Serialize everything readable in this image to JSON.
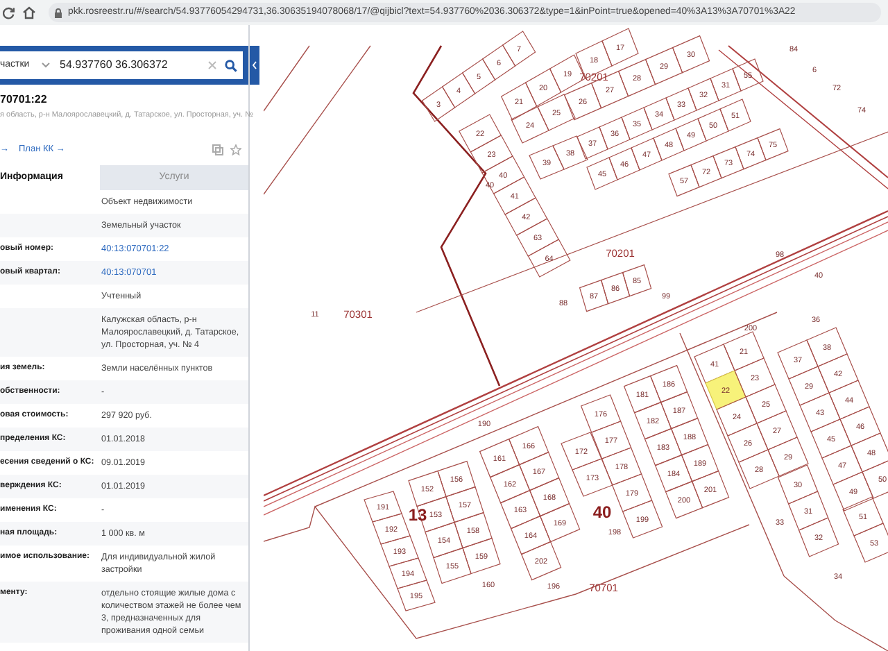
{
  "browser": {
    "url": "pkk.rosreestr.ru/#/search/54.93776054294731,36.30635194078068/17/@qijbicl?text=54.937760%2036.306372&type=1&inPoint=true&opened=40%3A13%3A70701%3A22"
  },
  "search": {
    "category": "частки",
    "value": "54.937760 36.306372"
  },
  "object": {
    "title": "70701:22",
    "address": "я область, р-н Малоярославецкий, д. Татарское, ул. Просторная, уч. №"
  },
  "links": [
    {
      "text": "→"
    },
    {
      "text": "План КК →"
    }
  ],
  "tabs": [
    {
      "label": "Информация",
      "selected": true
    },
    {
      "label": "Услуги",
      "selected": false
    }
  ],
  "rows": [
    {
      "value": "Объект недвижимости",
      "kind": "text"
    },
    {
      "value": "Земельный участок",
      "kind": "text"
    },
    {
      "label": "овый номер:",
      "value": "40:13:070701:22",
      "kind": "link"
    },
    {
      "label": "овый квартал:",
      "value": "40:13:070701",
      "kind": "link"
    },
    {
      "value": "Учтенный",
      "kind": "text"
    },
    {
      "value": "Калужская область, р-н Малоярославецкий, д. Татарское, ул. Просторная, уч. № 4",
      "kind": "text"
    },
    {
      "label": "ия земель:",
      "value": "Земли населённых пунктов",
      "kind": "text"
    },
    {
      "label": "обственности:",
      "value": "-",
      "kind": "text"
    },
    {
      "label": "овая стоимость:",
      "value": "297 920 руб.",
      "kind": "text"
    },
    {
      "label": "пределения КС:",
      "value": "01.01.2018",
      "kind": "text"
    },
    {
      "label": "есения сведений о КС:",
      "value": "09.01.2019",
      "kind": "text"
    },
    {
      "label": "верждения КС:",
      "value": "01.01.2019",
      "kind": "text"
    },
    {
      "label": "именения КС:",
      "value": "-",
      "kind": "text"
    },
    {
      "label": "ная площадь:",
      "value": "1 000 кв. м",
      "kind": "text"
    },
    {
      "label": "имое использование:",
      "value": "Для индивидуальной жилой застройки",
      "kind": "text"
    },
    {
      "label": "менту:",
      "value": "отдельно стоящие жилые дома с количеством этажей не более чем 3, предназначенных для проживания одной семьи",
      "kind": "text"
    }
  ],
  "map": {
    "blocks": [
      {
        "plots": [
          {
            "number": "3",
            "selected": false
          },
          {
            "number": "4",
            "selected": false
          },
          {
            "number": "5",
            "selected": false
          },
          {
            "number": "6",
            "selected": false
          },
          {
            "number": "7",
            "selected": false
          }
        ]
      },
      {
        "plots": [
          {
            "number": "21",
            "selected": false
          },
          {
            "number": "20",
            "selected": false
          },
          {
            "number": "19",
            "selected": false
          }
        ]
      },
      {
        "plots": [
          {
            "number": "26",
            "selected": false
          },
          {
            "number": "27",
            "selected": false
          },
          {
            "number": "28",
            "selected": false
          },
          {
            "number": "29",
            "selected": false
          },
          {
            "number": "30",
            "selected": false
          }
        ]
      },
      {
        "plots": [
          {
            "number": "18",
            "selected": false
          },
          {
            "number": "17",
            "selected": false
          }
        ]
      },
      {
        "plots": [
          {
            "number": "24",
            "selected": false
          },
          {
            "number": "25",
            "selected": false
          }
        ]
      },
      {
        "plots": [
          {
            "number": "22",
            "selected": false
          },
          {
            "number": "23",
            "selected": false
          },
          {
            "number": "40",
            "selected": false
          },
          {
            "number": "41",
            "selected": false
          },
          {
            "number": "42",
            "selected": false
          },
          {
            "number": "63",
            "selected": false
          },
          {
            "number": "64",
            "selected": false
          }
        ]
      },
      {
        "plots": [
          {
            "number": "39",
            "selected": false
          },
          {
            "number": "38",
            "selected": false
          }
        ]
      },
      {
        "plots": [
          {
            "number": "37",
            "selected": false
          },
          {
            "number": "36",
            "selected": false
          },
          {
            "number": "35",
            "selected": false
          },
          {
            "number": "34",
            "selected": false
          },
          {
            "number": "33",
            "selected": false
          },
          {
            "number": "32",
            "selected": false
          },
          {
            "number": "31",
            "selected": false
          },
          {
            "number": "55",
            "selected": false
          }
        ]
      },
      {
        "plots": [
          {
            "number": "45",
            "selected": false
          },
          {
            "number": "46",
            "selected": false
          },
          {
            "number": "47",
            "selected": false
          },
          {
            "number": "48",
            "selected": false
          },
          {
            "number": "49",
            "selected": false
          },
          {
            "number": "50",
            "selected": false
          },
          {
            "number": "51",
            "selected": false
          }
        ]
      },
      {
        "plots": [
          {
            "number": "57",
            "selected": false
          },
          {
            "number": "72",
            "selected": false
          },
          {
            "number": "73",
            "selected": false
          },
          {
            "number": "74",
            "selected": false
          },
          {
            "number": "75",
            "selected": false
          }
        ]
      },
      {
        "plots": [
          {
            "number": "87",
            "selected": false
          },
          {
            "number": "86",
            "selected": false
          },
          {
            "number": "85",
            "selected": false
          }
        ]
      },
      {
        "plots": [
          {
            "number": "191",
            "selected": false
          },
          {
            "number": "192",
            "selected": false
          },
          {
            "number": "193",
            "selected": false
          },
          {
            "number": "194",
            "selected": false
          },
          {
            "number": "195",
            "selected": false
          }
        ]
      },
      {
        "plots": [
          {
            "number": "152",
            "selected": false
          },
          {
            "number": "156",
            "selected": false
          },
          {
            "number": "153",
            "selected": false
          },
          {
            "number": "157",
            "selected": false
          },
          {
            "number": "154",
            "selected": false
          },
          {
            "number": "158",
            "selected": false
          },
          {
            "number": "155",
            "selected": false
          },
          {
            "number": "159",
            "selected": false
          }
        ]
      },
      {
        "plots": [
          {
            "number": "161",
            "selected": false
          },
          {
            "number": "166",
            "selected": false
          },
          {
            "number": "162",
            "selected": false
          },
          {
            "number": "167",
            "selected": false
          },
          {
            "number": "163",
            "selected": false
          },
          {
            "number": "168",
            "selected": false
          },
          {
            "number": "164",
            "selected": false
          },
          {
            "number": "169",
            "selected": false
          },
          {
            "number": "202",
            "selected": false
          }
        ]
      },
      {
        "plots": [
          {
            "number": "172",
            "selected": false
          },
          {
            "number": "173",
            "selected": false
          }
        ]
      },
      {
        "plots": [
          {
            "number": "176",
            "selected": false
          },
          {
            "number": "177",
            "selected": false
          },
          {
            "number": "178",
            "selected": false
          },
          {
            "number": "179",
            "selected": false
          },
          {
            "number": "199",
            "selected": false
          }
        ]
      },
      {
        "plots": [
          {
            "number": "181",
            "selected": false
          },
          {
            "number": "186",
            "selected": false
          },
          {
            "number": "182",
            "selected": false
          },
          {
            "number": "187",
            "selected": false
          },
          {
            "number": "183",
            "selected": false
          },
          {
            "number": "188",
            "selected": false
          },
          {
            "number": "184",
            "selected": false
          },
          {
            "number": "189",
            "selected": false
          },
          {
            "number": "200",
            "selected": false
          },
          {
            "number": "201",
            "selected": false
          }
        ]
      },
      {
        "plots": [
          {
            "number": "41",
            "selected": false
          },
          {
            "number": "21",
            "selected": false
          },
          {
            "number": "22",
            "selected": true
          },
          {
            "number": "23",
            "selected": false
          },
          {
            "number": "24",
            "selected": false
          },
          {
            "number": "25",
            "selected": false
          },
          {
            "number": "26",
            "selected": false
          },
          {
            "number": "27",
            "selected": false
          },
          {
            "number": "28",
            "selected": false
          },
          {
            "number": "29",
            "selected": false
          }
        ]
      },
      {
        "plots": [
          {
            "number": "30",
            "selected": false
          },
          {
            "number": "31",
            "selected": false
          },
          {
            "number": "32",
            "selected": false
          }
        ]
      },
      {
        "plots": [
          {
            "number": "37",
            "selected": false
          },
          {
            "number": "38",
            "selected": false
          },
          {
            "number": "29",
            "selected": false
          },
          {
            "number": "42",
            "selected": false
          },
          {
            "number": "43",
            "selected": false
          },
          {
            "number": "44",
            "selected": false
          },
          {
            "number": "45",
            "selected": false
          },
          {
            "number": "46",
            "selected": false
          },
          {
            "number": "47",
            "selected": false
          },
          {
            "number": "48",
            "selected": false
          },
          {
            "number": "49",
            "selected": false
          },
          {
            "number": "50",
            "selected": false
          }
        ]
      },
      {
        "plots": [
          {
            "number": "51",
            "selected": false
          },
          {
            "number": "53",
            "selected": false
          }
        ]
      }
    ],
    "labels": [
      {
        "text": "11",
        "kind": "plot"
      },
      {
        "text": "70301",
        "kind": "quarter"
      },
      {
        "text": "70201",
        "kind": "quarter"
      },
      {
        "text": "70201",
        "kind": "quarter"
      },
      {
        "text": "70701",
        "kind": "quarter"
      },
      {
        "text": "13",
        "kind": "big"
      },
      {
        "text": "40",
        "kind": "big"
      },
      {
        "text": "190",
        "kind": "plot"
      },
      {
        "text": "160",
        "kind": "plot"
      },
      {
        "text": "196",
        "kind": "plot"
      },
      {
        "text": "88",
        "kind": "plot"
      },
      {
        "text": "98",
        "kind": "plot"
      },
      {
        "text": "40",
        "kind": "plot"
      },
      {
        "text": "36",
        "kind": "plot"
      },
      {
        "text": "200",
        "kind": "plot"
      },
      {
        "text": "33",
        "kind": "plot"
      },
      {
        "text": "34",
        "kind": "plot"
      },
      {
        "text": "84",
        "kind": "plot"
      },
      {
        "text": "6",
        "kind": "plot"
      },
      {
        "text": "72",
        "kind": "plot"
      },
      {
        "text": "74",
        "kind": "plot"
      },
      {
        "text": "99",
        "kind": "plot"
      },
      {
        "text": "198",
        "kind": "plot"
      },
      {
        "text": "40",
        "kind": "plot"
      }
    ]
  }
}
